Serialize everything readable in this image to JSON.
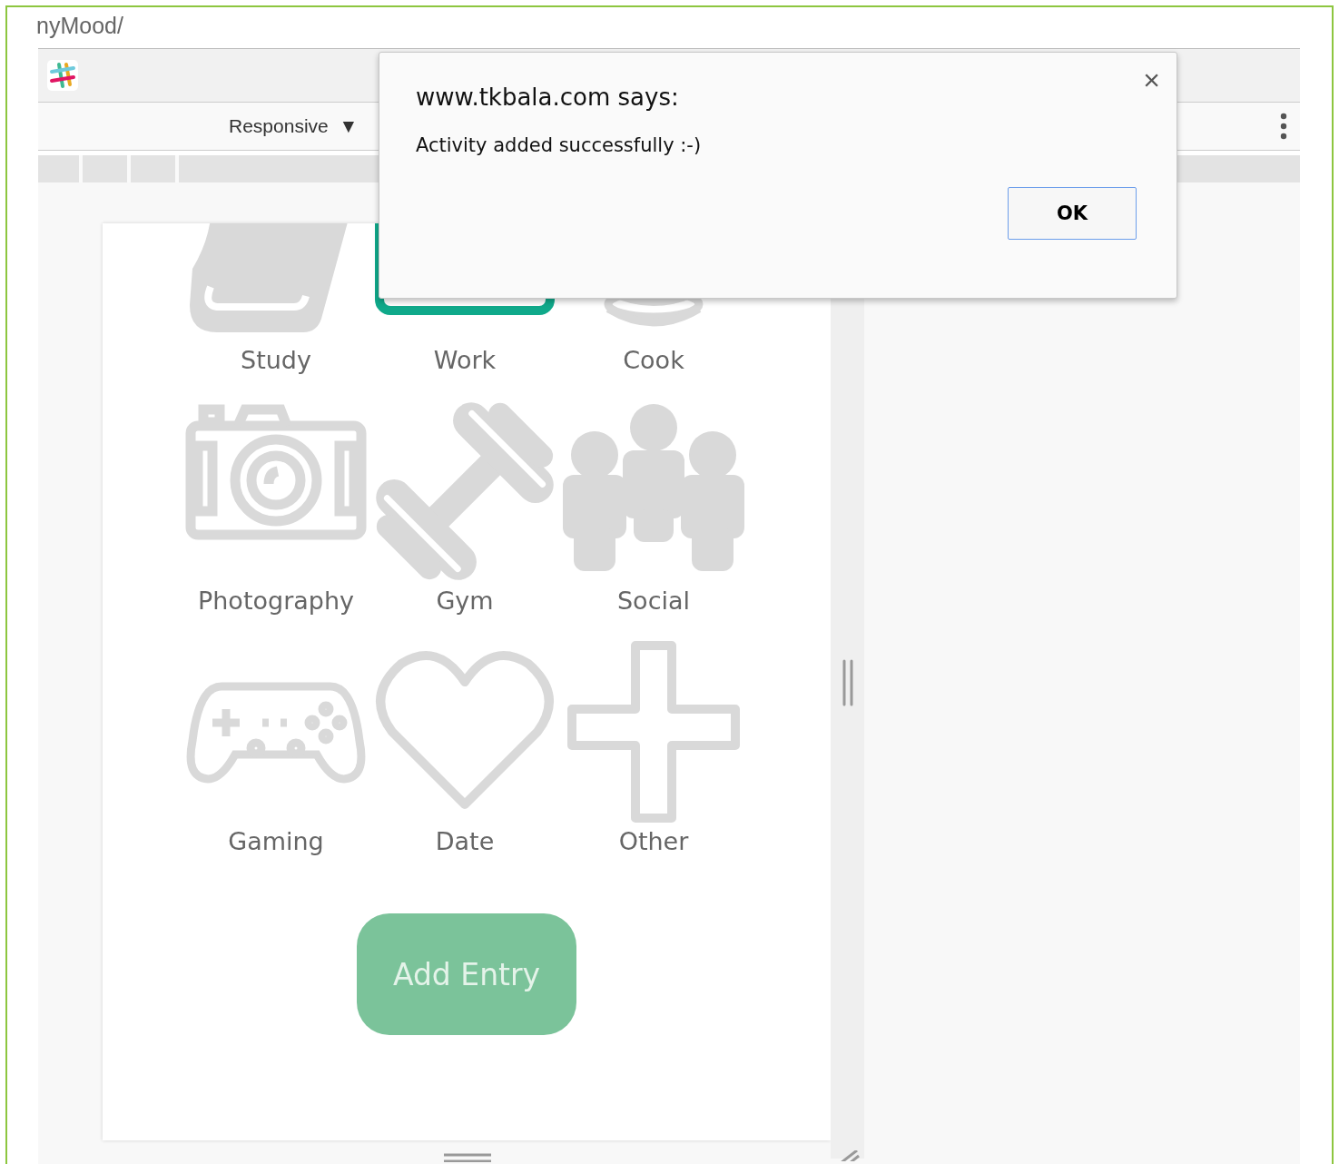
{
  "page_title": "nyMood/",
  "device_toolbar": {
    "device": "Responsive",
    "dropdown_glyph": "▼"
  },
  "activities": [
    {
      "label": "Study",
      "selected": false
    },
    {
      "label": "Work",
      "selected": true
    },
    {
      "label": "Cook",
      "selected": false
    },
    {
      "label": "Photography",
      "selected": false
    },
    {
      "label": "Gym",
      "selected": false
    },
    {
      "label": "Social",
      "selected": false
    },
    {
      "label": "Gaming",
      "selected": false
    },
    {
      "label": "Date",
      "selected": false
    },
    {
      "label": "Other",
      "selected": false
    }
  ],
  "add_button": "Add Entry",
  "dialog": {
    "title": "www.tkbala.com says:",
    "message": "Activity added successfully :-)",
    "close_glyph": "×",
    "ok_button": "OK"
  }
}
